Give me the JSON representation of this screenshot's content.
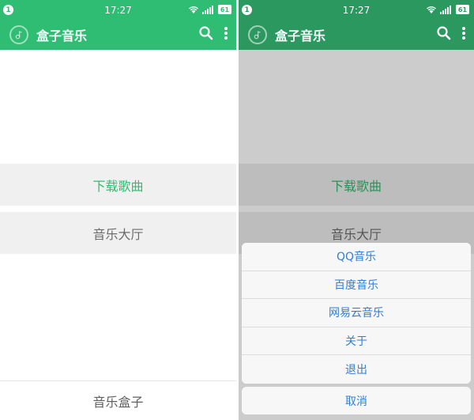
{
  "status_bar": {
    "notification_count": "1",
    "time": "17:27",
    "battery": "61"
  },
  "toolbar": {
    "title": "盒子音乐"
  },
  "main": {
    "download_label": "下载歌曲",
    "hall_label": "音乐大厅"
  },
  "footer": {
    "label": "音乐盒子"
  },
  "action_sheet": {
    "items": [
      {
        "label": "QQ音乐"
      },
      {
        "label": "百度音乐"
      },
      {
        "label": "网易云音乐"
      },
      {
        "label": "关于"
      },
      {
        "label": "退出"
      }
    ],
    "cancel_label": "取消"
  },
  "colors": {
    "primary": "#2ebd72",
    "primary_dimmed": "#2b9860",
    "link_blue": "#2f7ed8",
    "button_bg": "#f0f0f0"
  },
  "icons": {
    "logo": "music-note-circle-icon",
    "search": "search-icon",
    "overflow": "more-vertical-icon",
    "wifi": "wifi-icon",
    "signal": "signal-icon",
    "battery": "battery-icon"
  }
}
